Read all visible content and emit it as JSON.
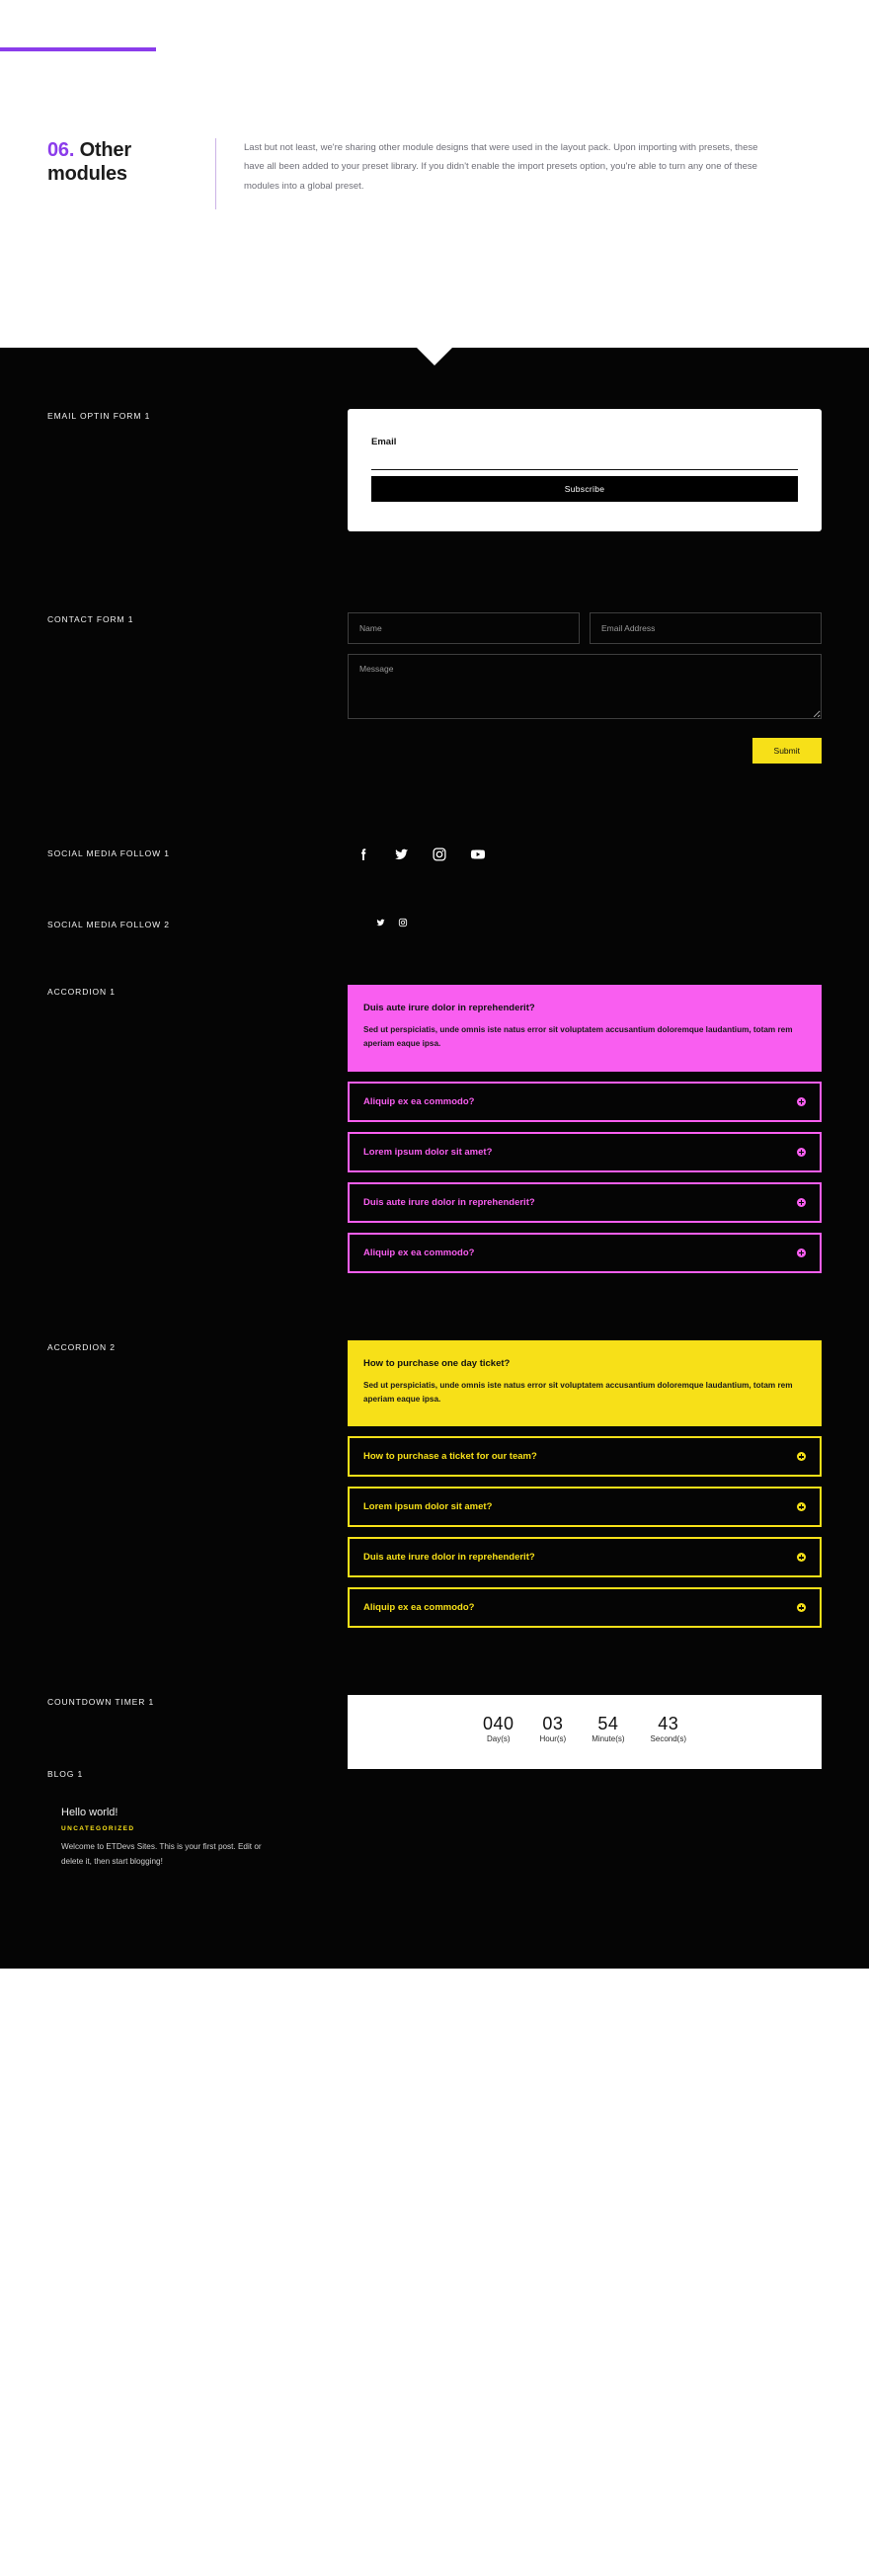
{
  "intro": {
    "heading_number": "06.",
    "heading_text": "Other modules",
    "body": "Last but not least, we're sharing other module designs that were used in the layout pack. Upon importing with presets, these have all been added to your preset library. If you didn't enable the import presets option, you're able to turn any one of these modules into a global preset.",
    "accent_color": "#8b3ceb"
  },
  "sections": {
    "optin_label": "EMAIL OPTIN FORM 1",
    "contact_label": "CONTACT FORM 1",
    "social1_label": "SOCIAL MEDIA FOLLOW 1",
    "social2_label": "SOCIAL MEDIA FOLLOW 2",
    "accordion1_label": "ACCORDION 1",
    "accordion2_label": "ACCORDION 2",
    "countdown_label": "COUNTDOWN TIMER 1",
    "blog_label": "BLOG 1"
  },
  "optin": {
    "field_label": "Email",
    "field_value": "",
    "field_placeholder": "",
    "button_label": "Subscribe"
  },
  "contact": {
    "name_placeholder": "Name",
    "name_value": "",
    "email_placeholder": "Email Address",
    "email_value": "",
    "message_placeholder": "Message",
    "message_value": "",
    "submit_label": "Submit",
    "submit_color": "#f7e018"
  },
  "social1": [
    {
      "name": "facebook-icon"
    },
    {
      "name": "twitter-icon"
    },
    {
      "name": "instagram-icon"
    },
    {
      "name": "youtube-icon"
    }
  ],
  "social2": [
    {
      "name": "twitter-icon"
    },
    {
      "name": "instagram-icon"
    }
  ],
  "accordion1": {
    "color": "#f95ef0",
    "open": {
      "title": "Duis aute irure dolor in reprehenderit?",
      "body": "Sed ut perspiciatis, unde omnis iste natus error sit voluptatem accusantium doloremque laudantium, totam rem aperiam eaque ipsa."
    },
    "items": [
      {
        "title": "Aliquip ex ea commodo?"
      },
      {
        "title": "Lorem ipsum dolor sit amet?"
      },
      {
        "title": "Duis aute irure dolor in reprehenderit?"
      },
      {
        "title": "Aliquip ex ea commodo?"
      }
    ]
  },
  "accordion2": {
    "color": "#f7e018",
    "open": {
      "title": "How to purchase one day ticket?",
      "body": "Sed ut perspiciatis, unde omnis iste natus error sit voluptatem accusantium doloremque laudantium, totam rem aperiam eaque ipsa."
    },
    "items": [
      {
        "title": "How to purchase a ticket for our team?"
      },
      {
        "title": "Lorem ipsum dolor sit amet?"
      },
      {
        "title": "Duis aute irure dolor in reprehenderit?"
      },
      {
        "title": "Aliquip ex ea commodo?"
      }
    ]
  },
  "countdown": {
    "units": [
      {
        "value": "040",
        "label": "Day(s)"
      },
      {
        "value": "03",
        "label": "Hour(s)"
      },
      {
        "value": "54",
        "label": "Minute(s)"
      },
      {
        "value": "43",
        "label": "Second(s)"
      }
    ]
  },
  "blog": {
    "title": "Hello world!",
    "category": "UNCATEGORIZED",
    "excerpt": "Welcome to ETDevs Sites. This is your first post. Edit or delete it, then start blogging!"
  }
}
